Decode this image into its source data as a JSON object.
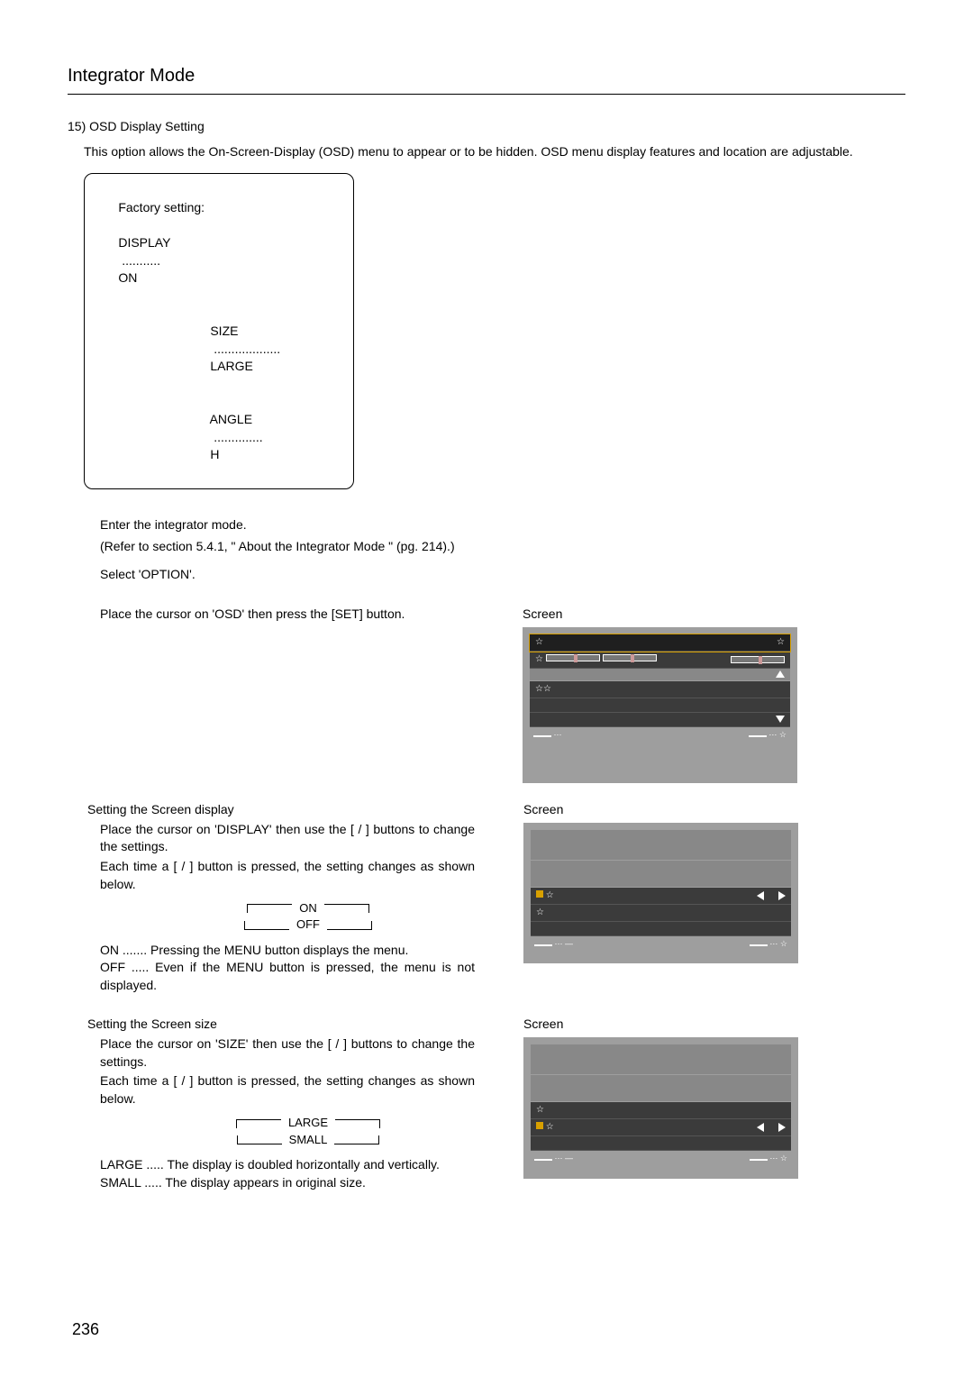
{
  "header": {
    "title": "Integrator Mode"
  },
  "section": {
    "num_title": "15) OSD Display Setting",
    "desc": "This option allows the On-Screen-Display (OSD) menu to appear or to be hidden. OSD menu display features and location are adjustable."
  },
  "factory": {
    "prefix": "Factory setting:",
    "r1a": "DISPLAY",
    "r1d": "...........",
    "r1b": "ON",
    "r2a": "SIZE",
    "r2d": "...................",
    "r2b": "LARGE",
    "r3a": "ANGLE",
    "r3d": "..............",
    "r3b": "H"
  },
  "steps": {
    "s1": "Enter the integrator mode.",
    "s1b": "(Refer to section 5.4.1, \" About the Integrator Mode \" (pg. 214).)",
    "s2": "Select 'OPTION'.",
    "s3": "Place the cursor on 'OSD' then press the [SET] button."
  },
  "screen_label": "Screen",
  "screenA": {
    "footer_left": "⋯",
    "footer_right_prefix": "⋯ ☆"
  },
  "setting_display": {
    "heading": "Setting the Screen display",
    "p1": "Place the cursor on 'DISPLAY' then use the [   /   ] buttons to change the settings.",
    "p2": "Each time a [   /   ] button is pressed, the setting changes as shown below.",
    "opt1": "ON",
    "opt2": "OFF",
    "def1_term": "ON",
    "def1_dots": ".......",
    "def1_body": "Pressing the MENU button displays the menu.",
    "def2_term": "OFF",
    "def2_dots": ".....",
    "def2_body": "Even if the MENU button is pressed, the menu is not displayed."
  },
  "setting_size": {
    "heading": "Setting the Screen size",
    "p1": "Place the cursor on 'SIZE' then use the [   /   ] buttons to change the settings.",
    "p2": "Each time a [   /   ] button is pressed, the setting changes as shown below.",
    "opt1": "LARGE",
    "opt2": "SMALL",
    "def1_term": "LARGE",
    "def1_dots": ".....",
    "def1_body": "The display is doubled horizontally and vertically.",
    "def2_term": "SMALL",
    "def2_dots": ".....",
    "def2_body": "The display appears in original size."
  },
  "page_number": "236"
}
